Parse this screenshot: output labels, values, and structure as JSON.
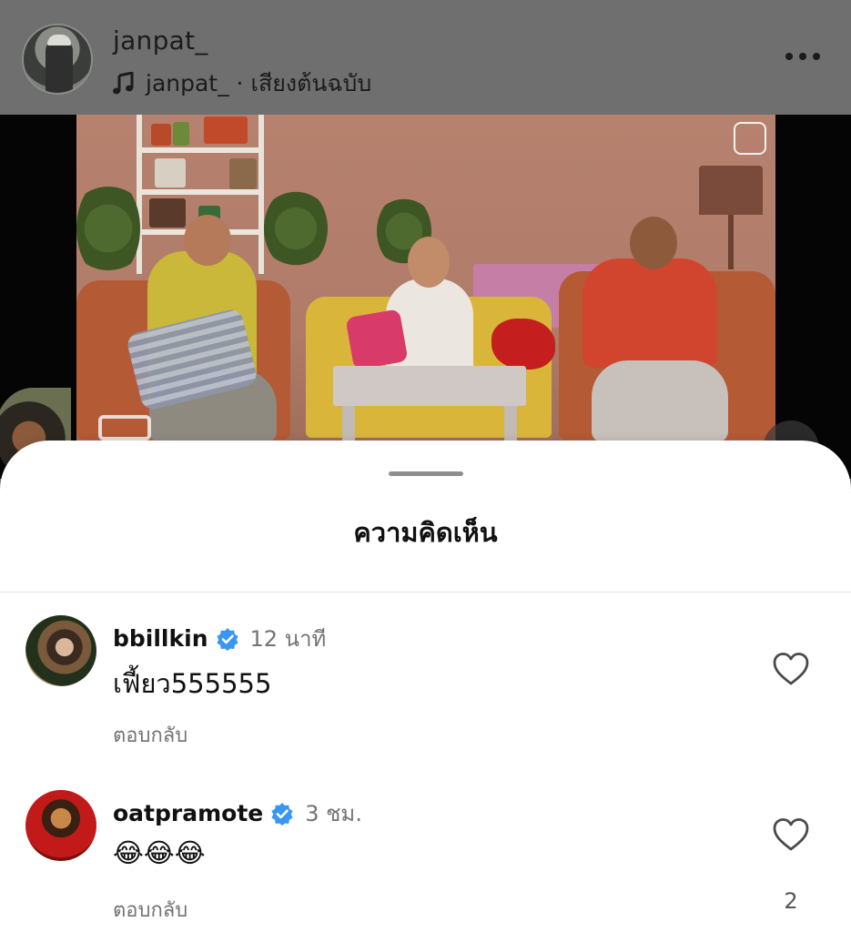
{
  "post": {
    "username": "janpat_",
    "audio": "janpat_ · เสียงต้นฉบับ"
  },
  "sheet": {
    "title": "ความคิดเห็น"
  },
  "comments": [
    {
      "username": "bbillkin",
      "verified": true,
      "time": "12 นาที",
      "text": "เฟี้ยว555555",
      "reply_label": "ตอบกลับ",
      "likes": ""
    },
    {
      "username": "oatpramote",
      "verified": true,
      "time": "3 ชม.",
      "text": "😂😂😂",
      "reply_label": "ตอบกลับ",
      "likes": "2"
    }
  ],
  "colors": {
    "verified_blue": "#3897f0",
    "secondary_text": "#737373"
  },
  "icons": [
    "music-note-icon",
    "more-icon",
    "verified-icon",
    "heart-icon"
  ]
}
